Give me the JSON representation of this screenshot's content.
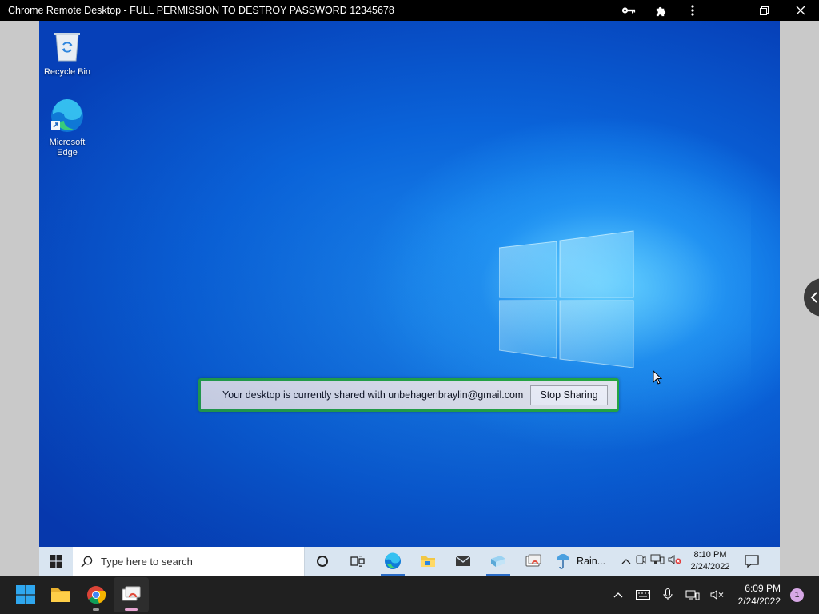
{
  "window": {
    "title": "Chrome Remote Desktop - FULL PERMISSION TO DESTROY PASSWORD 12345678"
  },
  "desktop": {
    "icons": [
      {
        "label": "Recycle Bin",
        "icon": "recycle-bin-icon"
      },
      {
        "label": "Microsoft Edge",
        "icon": "edge-icon"
      }
    ]
  },
  "share_banner": {
    "message": "Your desktop is currently shared with unbehagenbraylin@gmail.com",
    "stop_label": "Stop Sharing"
  },
  "remote_taskbar": {
    "search_placeholder": "Type here to search",
    "weather_label": "Rain...",
    "time": "8:10 PM",
    "date": "2/24/2022"
  },
  "local_taskbar": {
    "time": "6:09 PM",
    "date": "2/24/2022",
    "notification_count": "1"
  },
  "colors": {
    "banner_border": "#27b03a",
    "desktop_blue": "#0a63d9",
    "taskbar_dark": "#202020"
  }
}
